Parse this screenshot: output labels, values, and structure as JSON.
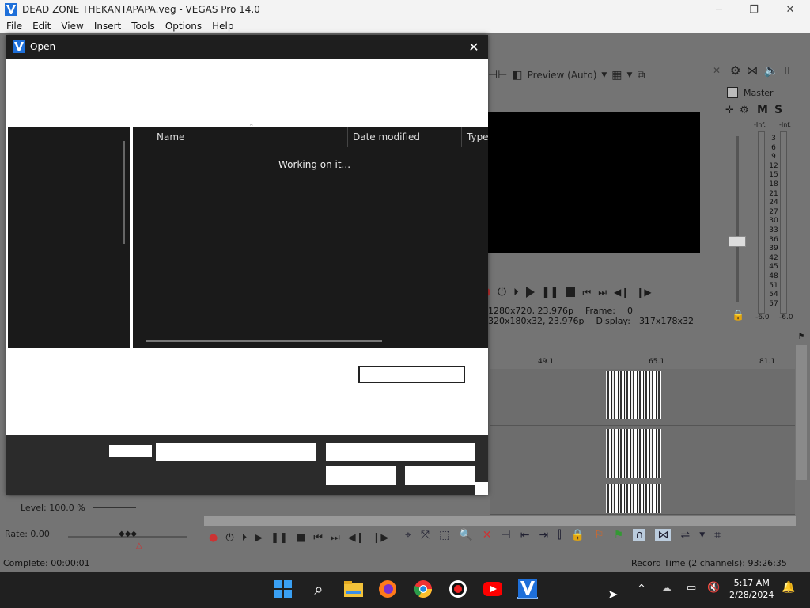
{
  "window": {
    "title": "DEAD ZONE THEKANTAPAPA.veg - VEGAS Pro 14.0",
    "minimize": "─",
    "restore": "❐",
    "close": "✕"
  },
  "menu": [
    "File",
    "Edit",
    "View",
    "Insert",
    "Tools",
    "Options",
    "Help"
  ],
  "preview": {
    "quality": "Preview (Auto)",
    "project_info": "1280x720, 23.976p",
    "preview_info": "320x180x32, 23.976p",
    "frame_label": "Frame:",
    "frame_value": "0",
    "display_label": "Display:",
    "display_value": "317x178x32"
  },
  "mixer": {
    "label": "Master",
    "m": "M",
    "s": "S",
    "inf_left": "-Inf.",
    "inf_right": "-Inf.",
    "scale": [
      "3",
      "6",
      "9",
      "12",
      "15",
      "18",
      "21",
      "24",
      "27",
      "30",
      "33",
      "36",
      "39",
      "42",
      "45",
      "48",
      "51",
      "54",
      "57"
    ],
    "bottom_left": "-6.0",
    "bottom_right": "-6.0"
  },
  "timeline": {
    "markers": [
      "49.1",
      "65.1",
      "81.1"
    ]
  },
  "track": {
    "level": "Level: 100.0 %"
  },
  "rate": "Rate: 0.00",
  "status": {
    "complete": "Complete: 00:00:01",
    "record_time": "Record Time (2 channels): 93:26:35"
  },
  "dialog": {
    "title": "Open",
    "close": "✕",
    "columns": [
      "Name",
      "Date modified",
      "Type"
    ],
    "loading": "Working on it..."
  },
  "clock": {
    "time": "5:17 AM",
    "date": "2/28/2024"
  },
  "colors": {
    "dark": "#1a1a1a",
    "taskbar": "#202020",
    "accent_blue": "#1e88e5"
  }
}
